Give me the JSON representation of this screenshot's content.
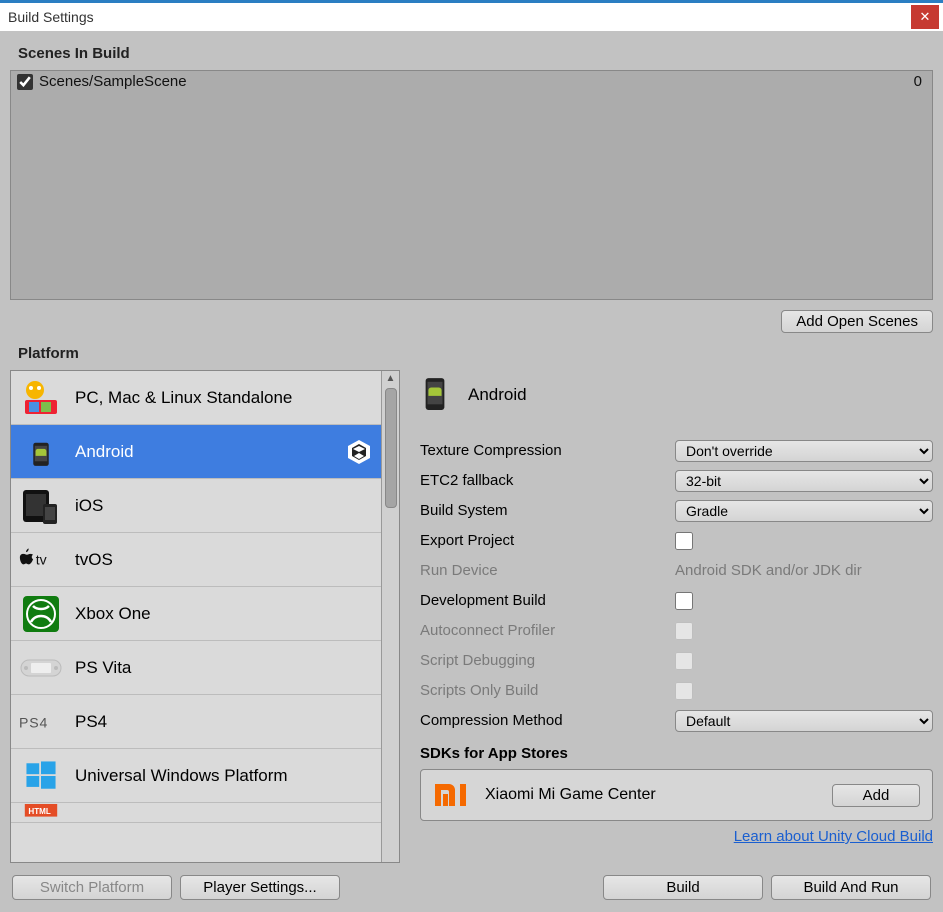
{
  "window": {
    "title": "Build Settings"
  },
  "scenes": {
    "label": "Scenes In Build",
    "items": [
      {
        "checked": true,
        "name": "Scenes/SampleScene",
        "index": "0"
      }
    ],
    "add_open": "Add Open Scenes"
  },
  "platform": {
    "label": "Platform",
    "items": [
      {
        "label": "PC, Mac & Linux Standalone",
        "icon": "pcmac"
      },
      {
        "label": "Android",
        "icon": "android",
        "selected": true,
        "unity_mark": true
      },
      {
        "label": "iOS",
        "icon": "ios"
      },
      {
        "label": "tvOS",
        "icon": "tvos"
      },
      {
        "label": "Xbox One",
        "icon": "xbox"
      },
      {
        "label": "PS Vita",
        "icon": "psvita"
      },
      {
        "label": "PS4",
        "icon": "ps4"
      },
      {
        "label": "Universal Windows Platform",
        "icon": "uwp"
      }
    ]
  },
  "details": {
    "title": "Android",
    "options": {
      "texture_compression": {
        "label": "Texture Compression",
        "value": "Don't override"
      },
      "etc2_fallback": {
        "label": "ETC2 fallback",
        "value": "32-bit"
      },
      "build_system": {
        "label": "Build System",
        "value": "Gradle"
      },
      "export_project": {
        "label": "Export Project"
      },
      "run_device": {
        "label": "Run Device",
        "value": "Android SDK and/or JDK dir"
      },
      "dev_build": {
        "label": "Development Build"
      },
      "autoconnect": {
        "label": "Autoconnect Profiler"
      },
      "script_debug": {
        "label": "Script Debugging"
      },
      "scripts_only": {
        "label": "Scripts Only Build"
      },
      "compression": {
        "label": "Compression Method",
        "value": "Default"
      }
    },
    "sdk": {
      "heading": "SDKs for App Stores",
      "name": "Xiaomi Mi Game Center",
      "add": "Add"
    },
    "learn_link": "Learn about Unity Cloud Build"
  },
  "buttons": {
    "switch_platform": "Switch Platform",
    "player_settings": "Player Settings...",
    "build": "Build",
    "build_and_run": "Build And Run"
  }
}
